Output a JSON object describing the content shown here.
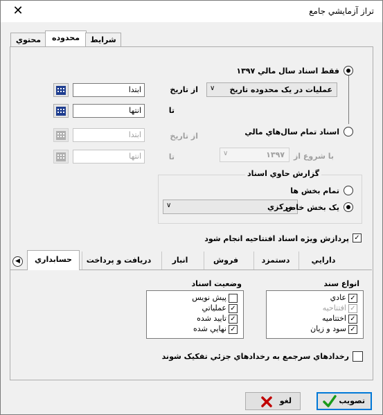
{
  "window": {
    "title": "تراز آزمایشي جامع",
    "close": "✕"
  },
  "tabs": [
    "شرايط",
    "محدوده",
    "محتوي"
  ],
  "range": {
    "opt_current": "فقط اسناد سال مالي ۱۳۹۷",
    "op_combo": "عمليات در يک محدوده تاريخ",
    "from_label": "از تاريخ",
    "from_value": "ابتدا",
    "to_label": "تا",
    "to_value": "انتها",
    "opt_all": "اسناد تمام سال‌هاي مالي",
    "from2_label": "از تاريخ",
    "from2_value": "ابتدا",
    "to2_label": "تا",
    "to2_value": "انتها",
    "start_label": "با شروع از",
    "start_value": "۱۳۹۷"
  },
  "report_group": {
    "title": "گزارش حاوي اسناد",
    "opt_all": "تمام بخش ها",
    "opt_one": "يک بخش خاص",
    "section_value": "مرکزي"
  },
  "opening_check": "پردازش ويژه اسناد افتتاحيه انجام شود",
  "bottom_tabs": [
    "حسابداري",
    "دريافت و پرداخت",
    "انبار",
    "فروش",
    "دستمزد",
    "دارايي"
  ],
  "doc_types": {
    "title": "انواع سند",
    "items": [
      {
        "label": "عادي",
        "checked": true,
        "disabled": false
      },
      {
        "label": "افتتاحيه",
        "checked": true,
        "disabled": true
      },
      {
        "label": "اختتاميه",
        "checked": true,
        "disabled": false
      },
      {
        "label": "سود و زيان",
        "checked": true,
        "disabled": false
      }
    ]
  },
  "doc_status": {
    "title": "وضعيت اسناد",
    "items": [
      {
        "label": "پيش نويس",
        "checked": false
      },
      {
        "label": "عملياتي",
        "checked": true
      },
      {
        "label": "تاييد شده",
        "checked": true
      },
      {
        "label": "نهايي شده",
        "checked": true
      }
    ]
  },
  "split_check": "رخدادهاي سرجمع به رخدادهاي جزئي تفکيک شوند",
  "buttons": {
    "ok": "تصويب",
    "cancel": "لغو"
  },
  "colors": {
    "accent": "#0078d7",
    "ok_icon": "#1a9a1a",
    "cancel_icon": "#c00000"
  }
}
